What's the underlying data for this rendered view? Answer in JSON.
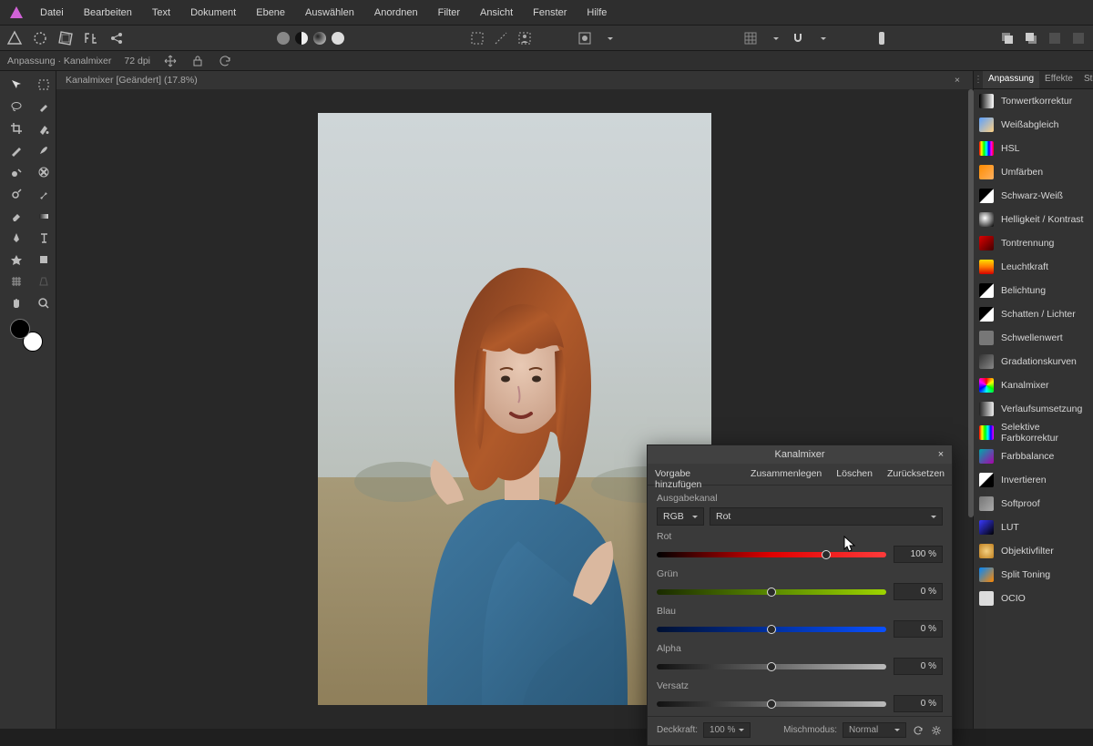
{
  "menu": {
    "items": [
      "Datei",
      "Bearbeiten",
      "Text",
      "Dokument",
      "Ebene",
      "Auswählen",
      "Anordnen",
      "Filter",
      "Ansicht",
      "Fenster",
      "Hilfe"
    ]
  },
  "contextbar": {
    "title": "Anpassung · Kanalmixer",
    "dpi": "72 dpi"
  },
  "doc_tab": {
    "label": "Kanalmixer [Geändert] (17.8%)"
  },
  "panel_tabs": {
    "a": "Anpassung",
    "b": "Effekte",
    "c": "Stile"
  },
  "adjustments": [
    {
      "label": "Tonwertkorrektur",
      "grad": "linear-gradient(90deg,#000,#fff)"
    },
    {
      "label": "Weißabgleich",
      "grad": "linear-gradient(135deg,#5aa0ff,#ffd080)"
    },
    {
      "label": "HSL",
      "grad": "linear-gradient(90deg,#f00,#ff0,#0f0,#0ff,#00f,#f0f,#f00)"
    },
    {
      "label": "Umfärben",
      "grad": "linear-gradient(135deg,#ff8c00,#ffb060)"
    },
    {
      "label": "Schwarz-Weiß",
      "grad": "linear-gradient(135deg,#000 49%,#fff 51%)"
    },
    {
      "label": "Helligkeit / Kontrast",
      "grad": "radial-gradient(circle at 40% 40%,#fff,#000)"
    },
    {
      "label": "Tontrennung",
      "grad": "linear-gradient(135deg,#d00,#400)"
    },
    {
      "label": "Leuchtkraft",
      "grad": "linear-gradient(0deg,#d40000,#ff7a00,#ffe000)"
    },
    {
      "label": "Belichtung",
      "grad": "linear-gradient(135deg,#000 49%,#fff 51%)"
    },
    {
      "label": "Schatten / Lichter",
      "grad": "linear-gradient(135deg,#000 49%,#fff 51%)"
    },
    {
      "label": "Schwellenwert",
      "grad": "linear-gradient(90deg,#777,#777)"
    },
    {
      "label": "Gradationskurven",
      "grad": "linear-gradient(135deg,#333,#888)"
    },
    {
      "label": "Kanalmixer",
      "grad": "conic-gradient(#f00,#ff0,#0f0,#0ff,#00f,#f0f,#f00)"
    },
    {
      "label": "Verlaufsumsetzung",
      "grad": "linear-gradient(90deg,#222,#eee)"
    },
    {
      "label": "Selektive Farbkorrektur",
      "grad": "linear-gradient(90deg,#f00,#ff0,#0f0,#0ff,#00f,#f0f)"
    },
    {
      "label": "Farbbalance",
      "grad": "linear-gradient(135deg,#0aa,#a0a)"
    },
    {
      "label": "Invertieren",
      "grad": "linear-gradient(135deg,#fff 49%,#000 51%)"
    },
    {
      "label": "Softproof",
      "grad": "linear-gradient(135deg,#777,#aaa)"
    },
    {
      "label": "LUT",
      "grad": "linear-gradient(135deg,#3a3aff,#000)"
    },
    {
      "label": "Objektivfilter",
      "grad": "radial-gradient(circle,#f5d080,#c08020)"
    },
    {
      "label": "Split Toning",
      "grad": "linear-gradient(135deg,#08f,#f80)"
    },
    {
      "label": "OCIO",
      "grad": "#ddd"
    }
  ],
  "dialog": {
    "title": "Kanalmixer",
    "actions": {
      "add": "Vorgabe hinzufügen",
      "merge": "Zusammenlegen",
      "delete": "Löschen",
      "reset": "Zurücksetzen"
    },
    "output_label": "Ausgabekanal",
    "model": "RGB",
    "channel": "Rot",
    "sliders": [
      {
        "label": "Rot",
        "class": "track-red",
        "pos": 74,
        "value": "100 %"
      },
      {
        "label": "Grün",
        "class": "track-green",
        "pos": 50,
        "value": "0 %"
      },
      {
        "label": "Blau",
        "class": "track-blue",
        "pos": 50,
        "value": "0 %"
      },
      {
        "label": "Alpha",
        "class": "track-gray",
        "pos": 50,
        "value": "0 %"
      },
      {
        "label": "Versatz",
        "class": "track-gray",
        "pos": 50,
        "value": "0 %"
      }
    ],
    "footer": {
      "opacity_label": "Deckkraft:",
      "opacity_value": "100 %",
      "blend_label": "Mischmodus:",
      "blend_value": "Normal"
    }
  }
}
